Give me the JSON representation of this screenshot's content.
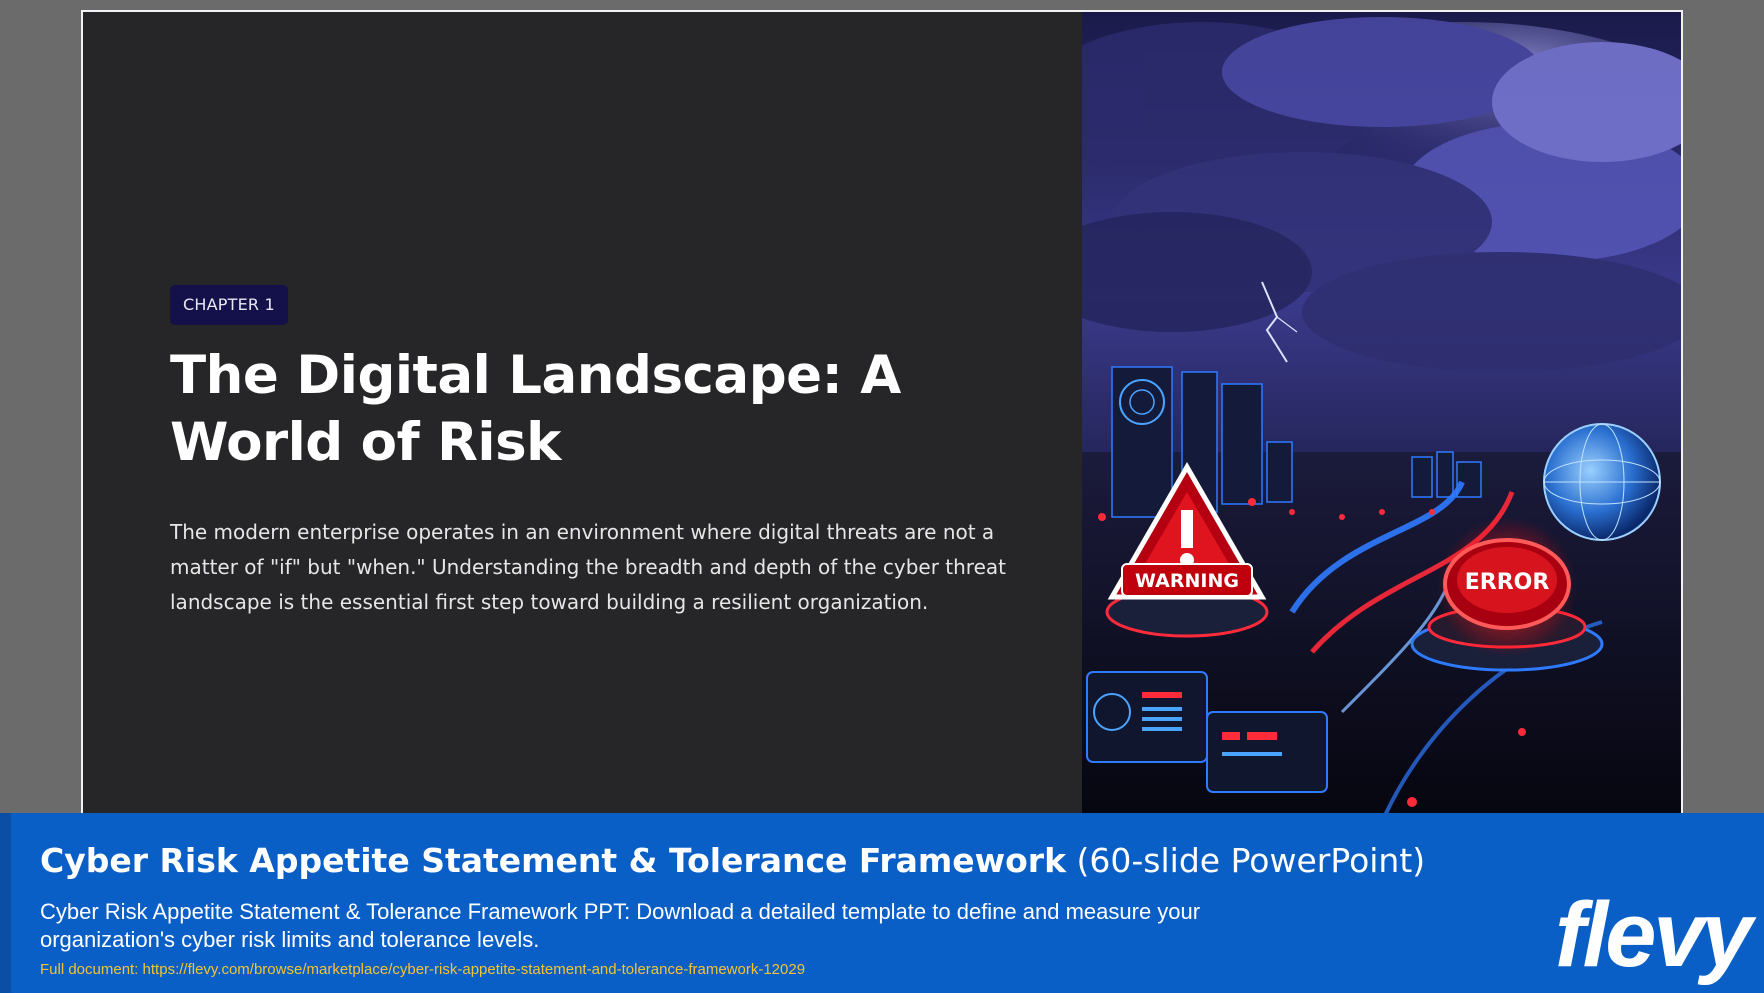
{
  "slide": {
    "chapter_label": "CHAPTER 1",
    "title": "The Digital Landscape: A World of Risk",
    "body": "The modern enterprise operates in an environment where digital threats are not a matter of \"if\" but \"when.\" Understanding the breadth and depth of the cyber threat landscape is the essential first step toward building a resilient organization.",
    "image": {
      "warning_sign_text": "WARNING",
      "error_sign_text": "ERROR"
    }
  },
  "banner": {
    "title_strong": "Cyber Risk Appetite Statement & Tolerance Framework",
    "title_light": "(60-slide PowerPoint)",
    "description": "Cyber Risk Appetite Statement & Tolerance Framework PPT: Download a detailed template to define and measure your organization's cyber risk limits and tolerance levels.",
    "link": "Full document: https://flevy.com/browse/marketplace/cyber-risk-appetite-statement-and-tolerance-framework-12029",
    "logo": "flevy"
  },
  "colors": {
    "slide_background": "#262527",
    "chapter_badge": "#14104a",
    "banner_background": "#0a5fc7",
    "link_color": "#f4c430",
    "warning_red": "#e0141e",
    "neon_blue": "#2f7bff"
  }
}
